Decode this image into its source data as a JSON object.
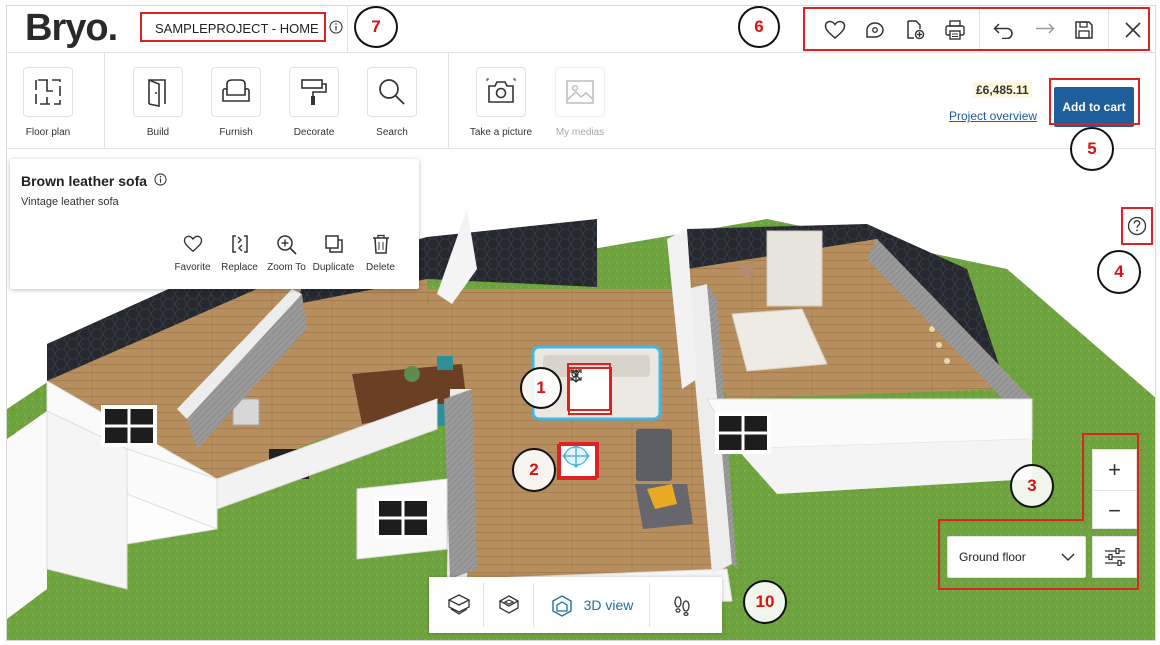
{
  "app": {
    "logo": "Bryo."
  },
  "header": {
    "project_title": "SAMPLEPROJECT - HOME"
  },
  "top_actions": [
    "heart-icon",
    "measure-icon",
    "export-icon",
    "print-icon",
    "undo-icon",
    "redo-icon",
    "save-icon",
    "close-icon"
  ],
  "toolbar": {
    "items": [
      {
        "label": "Floor plan",
        "icon": "floor-plan-icon"
      },
      {
        "label": "Build",
        "icon": "door-icon"
      },
      {
        "label": "Furnish",
        "icon": "armchair-icon"
      },
      {
        "label": "Decorate",
        "icon": "paint-roller-icon"
      },
      {
        "label": "Search",
        "icon": "search-icon"
      },
      {
        "label": "Take a picture",
        "icon": "camera-icon"
      },
      {
        "label": "My medias",
        "icon": "image-icon"
      }
    ],
    "price": "£6,485.11",
    "project_overview": "Project overview",
    "add_to_cart": "Add to cart"
  },
  "selection": {
    "title": "Brown leather sofa",
    "subtitle": "Vintage leather sofa",
    "actions": [
      {
        "label": "Favorite",
        "icon": "heart-icon"
      },
      {
        "label": "Replace",
        "icon": "replace-icon"
      },
      {
        "label": "Zoom To",
        "icon": "zoom-in-icon"
      },
      {
        "label": "Duplicate",
        "icon": "duplicate-icon"
      },
      {
        "label": "Delete",
        "icon": "trash-icon"
      }
    ]
  },
  "zoom": {
    "plus": "+",
    "minus": "−"
  },
  "floor": {
    "selected": "Ground floor"
  },
  "view_bar": {
    "active_label": "3D view"
  },
  "annotations": [
    "1",
    "2",
    "3",
    "4",
    "5",
    "6",
    "7",
    "10"
  ],
  "colors": {
    "accent": "#1e5e9b",
    "annotation": "#d22222",
    "grass": "#6fa33f"
  }
}
